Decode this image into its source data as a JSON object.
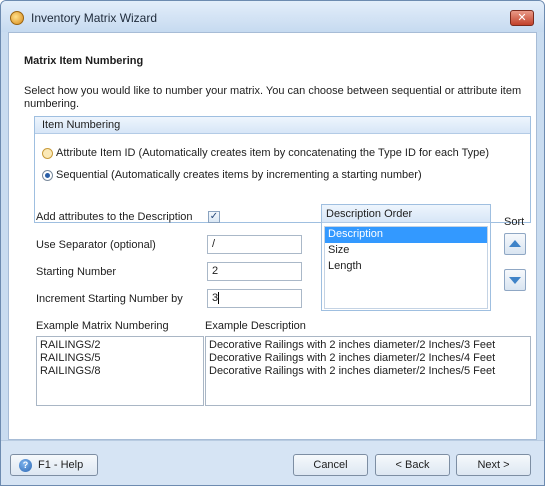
{
  "window": {
    "title": "Inventory Matrix Wizard",
    "close_symbol": "✕"
  },
  "page": {
    "heading": "Matrix Item Numbering",
    "instructions": "Select how you would like to number your matrix.  You can choose between sequential or attribute item numbering."
  },
  "item_numbering": {
    "header": "Item Numbering",
    "options": [
      {
        "label": "Attribute Item ID (Automatically creates item by concatenating the Type ID for each Type)",
        "checked": false
      },
      {
        "label": "Sequential (Automatically creates items by incrementing a starting number)",
        "checked": true
      }
    ]
  },
  "fields": {
    "add_attributes_label": "Add attributes to the Description",
    "add_attributes_checked": true,
    "separator_label": "Use Separator (optional)",
    "separator_value": "/",
    "starting_number_label": "Starting Number",
    "starting_number_value": "2",
    "increment_label": "Increment Starting Number by",
    "increment_value": "3"
  },
  "description_order": {
    "header": "Description Order",
    "items": [
      "Description",
      "Size",
      "Length"
    ],
    "selected": "Description"
  },
  "sort": {
    "label": "Sort"
  },
  "examples": {
    "numbering_label": "Example Matrix Numbering",
    "numbering": [
      "RAILINGS/2",
      "RAILINGS/5",
      "RAILINGS/8"
    ],
    "description_label": "Example Description",
    "descriptions": [
      "Decorative Railings with 2 inches diameter/2 Inches/3 Feet",
      "Decorative Railings with 2 inches diameter/2 Inches/4 Feet",
      "Decorative Railings with 2 inches diameter/2 Inches/5 Feet"
    ]
  },
  "footer": {
    "help_icon_text": "?",
    "help_label": "F1 - Help",
    "cancel_label": "Cancel",
    "back_label": "< Back",
    "next_label": "Next >"
  },
  "colors": {
    "selection": "#3399ff",
    "title_bar": "#c6daf0",
    "footer": "#d6e4f4"
  }
}
